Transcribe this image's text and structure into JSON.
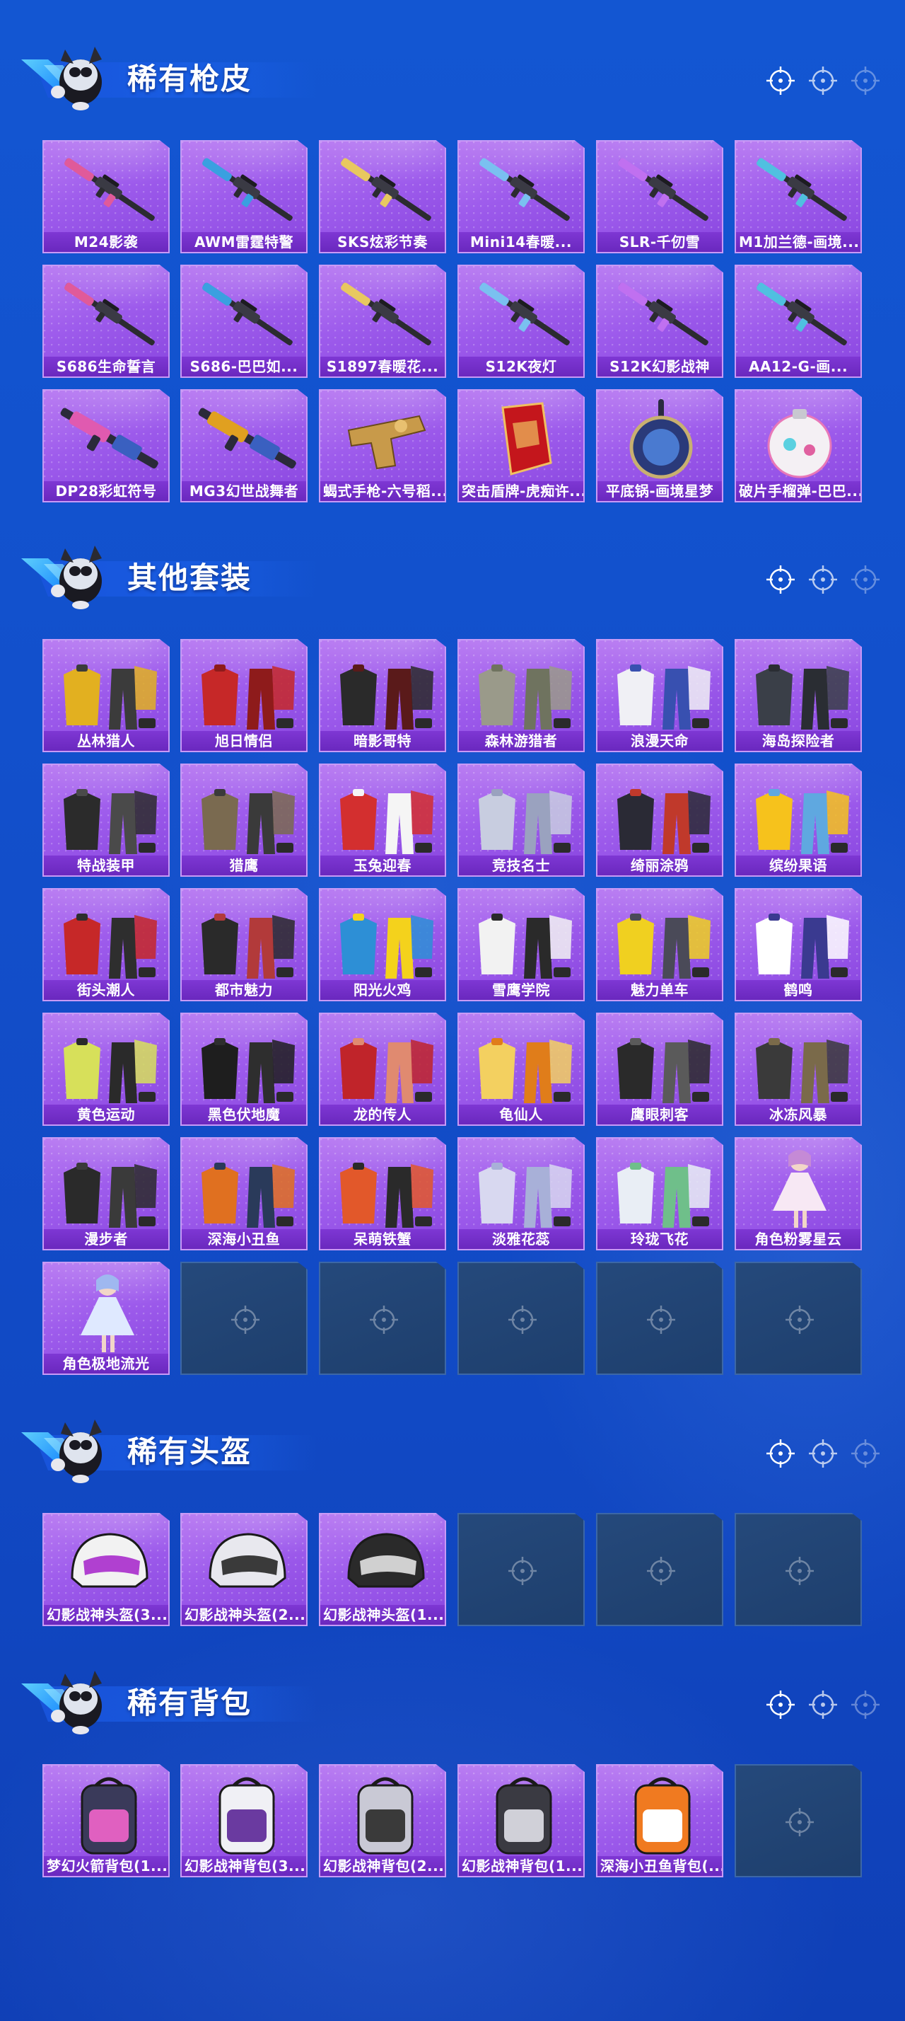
{
  "sections": [
    {
      "title": "稀有枪皮",
      "items": [
        {
          "label": "M24影袭",
          "icon": "rifle-icon"
        },
        {
          "label": "AWM雷霆特警",
          "icon": "rifle-icon"
        },
        {
          "label": "SKS炫彩节奏",
          "icon": "rifle-icon"
        },
        {
          "label": "Mini14春暖...",
          "icon": "rifle-icon"
        },
        {
          "label": "SLR-千仞雪",
          "icon": "rifle-icon"
        },
        {
          "label": "M1加兰德-画境...",
          "icon": "rifle-icon"
        },
        {
          "label": "S686生命誓言",
          "icon": "shotgun-icon"
        },
        {
          "label": "S686-巴巴如...",
          "icon": "shotgun-icon"
        },
        {
          "label": "S1897春暖花...",
          "icon": "shotgun-icon"
        },
        {
          "label": "S12K夜灯",
          "icon": "rifle-icon"
        },
        {
          "label": "S12K幻影战神",
          "icon": "rifle-icon"
        },
        {
          "label": "AA12-G-画...",
          "icon": "rifle-icon"
        },
        {
          "label": "DP28彩虹符号",
          "icon": "machine-gun-icon"
        },
        {
          "label": "MG3幻世战舞者",
          "icon": "machine-gun-icon"
        },
        {
          "label": "蝎式手枪-六号稻...",
          "icon": "pistol-icon"
        },
        {
          "label": "突击盾牌-虎痴许...",
          "icon": "shield-icon"
        },
        {
          "label": "平底锅-画境星梦",
          "icon": "pan-icon"
        },
        {
          "label": "破片手榴弹-巴巴...",
          "icon": "grenade-icon"
        }
      ]
    },
    {
      "title": "其他套装",
      "items": [
        {
          "label": "丛林猎人",
          "icon": "outfit-icon",
          "colors": [
            "#e2b020",
            "#3b3b3b"
          ]
        },
        {
          "label": "旭日情侣",
          "icon": "outfit-icon",
          "colors": [
            "#c62828",
            "#8e1b1b"
          ]
        },
        {
          "label": "暗影哥特",
          "icon": "outfit-icon",
          "colors": [
            "#2a2a2a",
            "#5a1a1a"
          ]
        },
        {
          "label": "森林游猎者",
          "icon": "outfit-icon",
          "colors": [
            "#9a9a8a",
            "#6f735f"
          ]
        },
        {
          "label": "浪漫天命",
          "icon": "outfit-icon",
          "colors": [
            "#f0f0f5",
            "#3850b0"
          ]
        },
        {
          "label": "海岛探险者",
          "icon": "outfit-icon",
          "colors": [
            "#3a3f48",
            "#2a2d33"
          ]
        },
        {
          "label": "特战装甲",
          "icon": "outfit-icon",
          "colors": [
            "#2b2b2b",
            "#4a4a4a"
          ]
        },
        {
          "label": "猎鹰",
          "icon": "outfit-icon",
          "colors": [
            "#7a6a50",
            "#3a3a3a"
          ]
        },
        {
          "label": "玉兔迎春",
          "icon": "outfit-icon",
          "colors": [
            "#d32f2f",
            "#f5f5f5"
          ]
        },
        {
          "label": "竞技名士",
          "icon": "outfit-icon",
          "colors": [
            "#c8cde0",
            "#9aa2bf"
          ]
        },
        {
          "label": "绮丽涂鸦",
          "icon": "outfit-icon",
          "colors": [
            "#2a2a35",
            "#c0392b"
          ]
        },
        {
          "label": "缤纷果语",
          "icon": "outfit-icon",
          "colors": [
            "#f6c21c",
            "#5fa8e0"
          ]
        },
        {
          "label": "街头潮人",
          "icon": "outfit-icon",
          "colors": [
            "#c62828",
            "#2e2e2e"
          ]
        },
        {
          "label": "都市魅力",
          "icon": "outfit-icon",
          "colors": [
            "#2a2a2a",
            "#b23a3a"
          ]
        },
        {
          "label": "阳光火鸡",
          "icon": "outfit-icon",
          "colors": [
            "#2d8fd6",
            "#f4d21c"
          ]
        },
        {
          "label": "雪鹰学院",
          "icon": "outfit-icon",
          "colors": [
            "#f2f2f2",
            "#2a2a2a"
          ]
        },
        {
          "label": "魅力单车",
          "icon": "outfit-icon",
          "colors": [
            "#f0d020",
            "#4a4a58"
          ]
        },
        {
          "label": "鹤鸣",
          "icon": "outfit-icon",
          "colors": [
            "#ffffff",
            "#3a3a90"
          ]
        },
        {
          "label": "黄色运动",
          "icon": "outfit-icon",
          "colors": [
            "#d7e05a",
            "#2a2a2a"
          ]
        },
        {
          "label": "黑色伏地魔",
          "icon": "outfit-icon",
          "colors": [
            "#1e1e1e",
            "#2e2e2e"
          ]
        },
        {
          "label": "龙的传人",
          "icon": "outfit-icon",
          "colors": [
            "#c0242a",
            "#e08a70"
          ]
        },
        {
          "label": "龟仙人",
          "icon": "outfit-icon",
          "colors": [
            "#f3d060",
            "#e07d1a"
          ]
        },
        {
          "label": "鹰眼刺客",
          "icon": "outfit-icon",
          "colors": [
            "#2a2a2a",
            "#5a5a5a"
          ]
        },
        {
          "label": "冰冻风暴",
          "icon": "outfit-icon",
          "colors": [
            "#3a3a3a",
            "#7a6a4a"
          ]
        },
        {
          "label": "漫步者",
          "icon": "outfit-icon",
          "colors": [
            "#2a2a2a",
            "#3a3a3a"
          ]
        },
        {
          "label": "深海小丑鱼",
          "icon": "outfit-icon",
          "colors": [
            "#e07020",
            "#2a3a5a"
          ]
        },
        {
          "label": "呆萌铁蟹",
          "icon": "outfit-icon",
          "colors": [
            "#e2582a",
            "#2a2a2a"
          ]
        },
        {
          "label": "淡雅花蕊",
          "icon": "outfit-icon",
          "colors": [
            "#d8d8f0",
            "#a8b0d8"
          ]
        },
        {
          "label": "玲珑飞花",
          "icon": "outfit-icon",
          "colors": [
            "#e9eef5",
            "#6fbf8a"
          ]
        },
        {
          "label": "角色粉雾星云",
          "icon": "character-icon",
          "colors": [
            "#f7e8f4",
            "#c58ad6"
          ]
        },
        {
          "label": "角色极地流光",
          "icon": "character-icon",
          "colors": [
            "#dfe9ff",
            "#9fb8f0"
          ]
        },
        null,
        null,
        null,
        null,
        null
      ]
    },
    {
      "title": "稀有头盔",
      "items": [
        {
          "label": "幻影战神头盔(3...",
          "icon": "helmet-icon",
          "colors": [
            "#f2f2f2",
            "#b040d0"
          ]
        },
        {
          "label": "幻影战神头盔(2...",
          "icon": "helmet-icon",
          "colors": [
            "#e8e8ee",
            "#3a3a3a"
          ]
        },
        {
          "label": "幻影战神头盔(1...",
          "icon": "helmet-icon",
          "colors": [
            "#2a2a2a",
            "#d0d0d0"
          ]
        },
        null,
        null,
        null
      ]
    },
    {
      "title": "稀有背包",
      "items": [
        {
          "label": "梦幻火箭背包(1...",
          "icon": "backpack-icon",
          "colors": [
            "#3a3a5a",
            "#e060c0"
          ]
        },
        {
          "label": "幻影战神背包(3...",
          "icon": "backpack-icon",
          "colors": [
            "#f0f0f5",
            "#6a3aa0"
          ]
        },
        {
          "label": "幻影战神背包(2...",
          "icon": "backpack-icon",
          "colors": [
            "#c9c9d5",
            "#3a3a3a"
          ]
        },
        {
          "label": "幻影战神背包(1...",
          "icon": "backpack-icon",
          "colors": [
            "#3a3a42",
            "#d0d0d8"
          ]
        },
        {
          "label": "深海小丑鱼背包(...",
          "icon": "backpack-icon",
          "colors": [
            "#f07a20",
            "#ffffff"
          ]
        },
        null
      ]
    }
  ]
}
